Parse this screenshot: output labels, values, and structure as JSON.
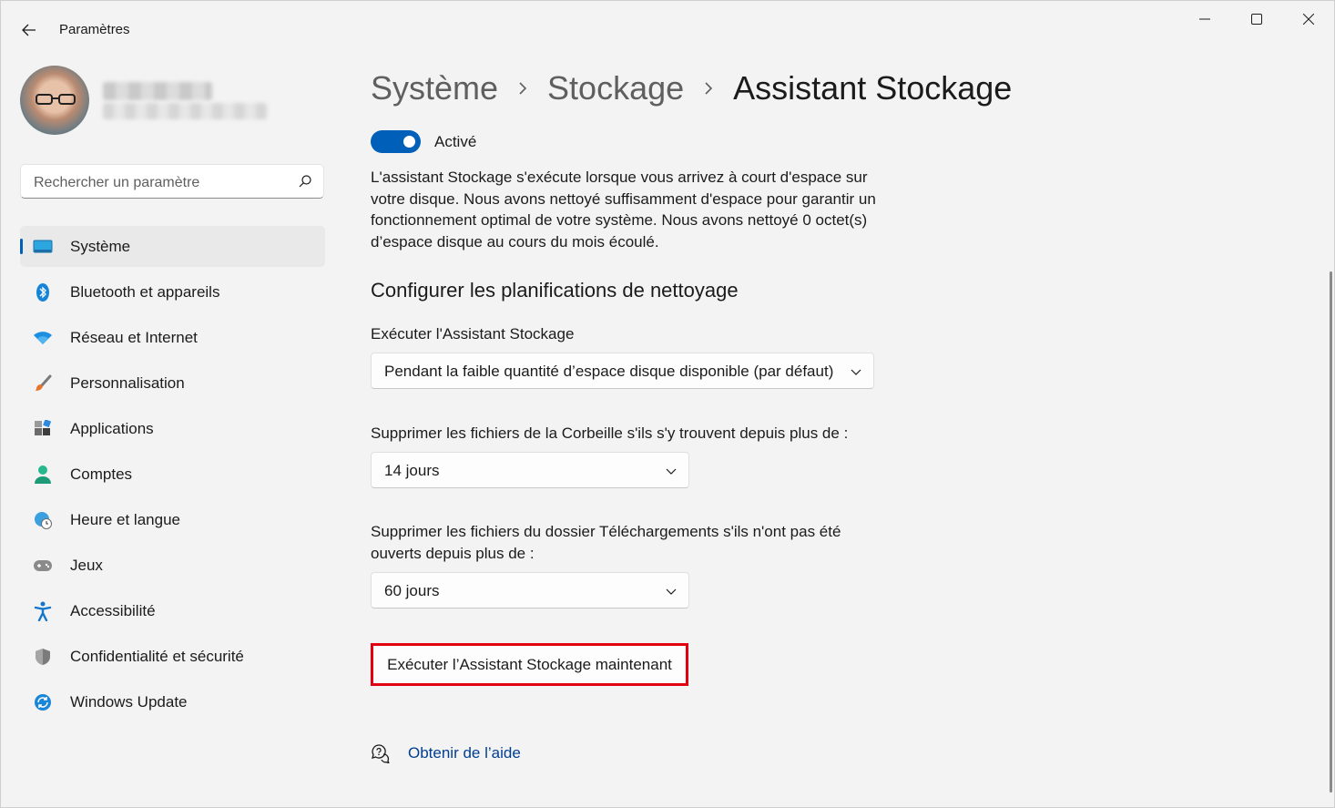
{
  "window": {
    "title": "Paramètres"
  },
  "sidebar": {
    "search_placeholder": "Rechercher un paramètre",
    "items": [
      {
        "label": "Système",
        "icon": "display-icon",
        "active": true
      },
      {
        "label": "Bluetooth et appareils",
        "icon": "bluetooth-icon"
      },
      {
        "label": "Réseau et Internet",
        "icon": "wifi-icon"
      },
      {
        "label": "Personnalisation",
        "icon": "brush-icon"
      },
      {
        "label": "Applications",
        "icon": "apps-icon"
      },
      {
        "label": "Comptes",
        "icon": "person-icon"
      },
      {
        "label": "Heure et langue",
        "icon": "globe-clock-icon"
      },
      {
        "label": "Jeux",
        "icon": "gamepad-icon"
      },
      {
        "label": "Accessibilité",
        "icon": "accessibility-icon"
      },
      {
        "label": "Confidentialité et sécurité",
        "icon": "shield-icon"
      },
      {
        "label": "Windows Update",
        "icon": "update-icon"
      }
    ]
  },
  "main": {
    "breadcrumb": [
      "Système",
      "Stockage",
      "Assistant Stockage"
    ],
    "toggle": {
      "label": "Activé",
      "on": true
    },
    "description": "L'assistant Stockage s'exécute lorsque vous arrivez à court d'espace sur votre disque. Nous avons nettoyé suffisamment d'espace pour garantir un fonctionnement optimal de votre système. Nous avons nettoyé 0 octet(s) d’espace disque au cours du mois écoulé.",
    "section_title": "Configurer les planifications de nettoyage",
    "run_label": "Exécuter l'Assistant Stockage",
    "run_value": "Pendant la faible quantité d’espace disque disponible (par défaut)",
    "recycle_label": "Supprimer les fichiers de la Corbeille s'ils s'y trouvent depuis plus de :",
    "recycle_value": "14 jours",
    "downloads_label": "Supprimer les fichiers du dossier Téléchargements s'ils n'ont pas été ouverts depuis plus de :",
    "downloads_value": "60 jours",
    "run_now_button": "Exécuter l’Assistant Stockage maintenant",
    "help_link": "Obtenir de l’aide"
  },
  "colors": {
    "accent": "#005fb8",
    "highlight_border": "#e0000f",
    "link": "#003e92",
    "background": "#f3f3f3"
  }
}
